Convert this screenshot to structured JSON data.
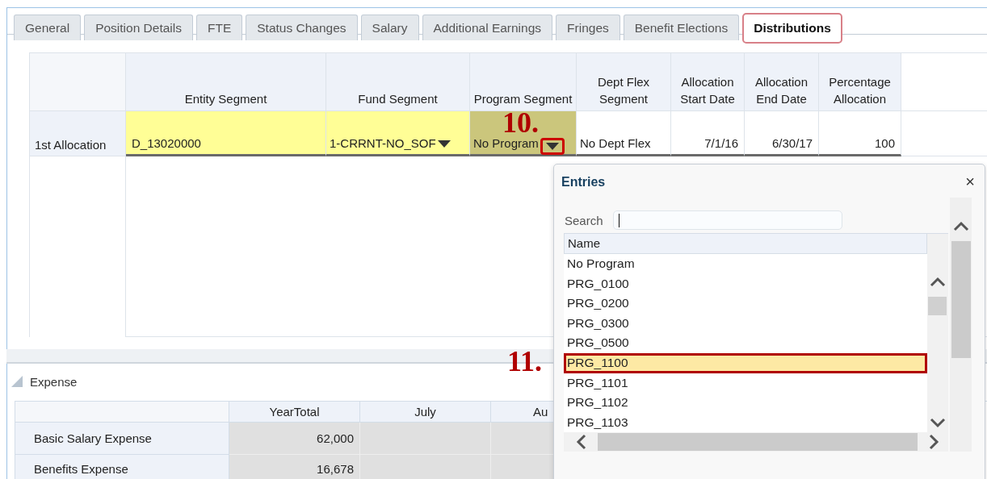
{
  "tabs": [
    {
      "label": "General",
      "selected": false
    },
    {
      "label": "Position Details",
      "selected": false
    },
    {
      "label": "FTE",
      "selected": false
    },
    {
      "label": "Status Changes",
      "selected": false
    },
    {
      "label": "Salary",
      "selected": false
    },
    {
      "label": "Additional Earnings",
      "selected": false
    },
    {
      "label": "Fringes",
      "selected": false
    },
    {
      "label": "Benefit Elections",
      "selected": false
    },
    {
      "label": "Distributions",
      "selected": true
    }
  ],
  "allocation_table": {
    "columns": [
      "Entity Segment",
      "Fund Segment",
      "Program Segment",
      "Dept Flex Segment",
      "Allocation Start Date",
      "Allocation End Date",
      "Percentage Allocation"
    ],
    "rows": [
      {
        "label": "1st Allocation",
        "cells": [
          {
            "kind": "field",
            "value": "D_13020000"
          },
          {
            "kind": "dropdown",
            "value": "1-CRRNT-NO_SOF",
            "active": false
          },
          {
            "kind": "dropdown",
            "value": "No Program",
            "active": true,
            "callout": "10."
          },
          {
            "kind": "text",
            "value": "No Dept Flex"
          },
          {
            "kind": "number",
            "value": "7/1/16"
          },
          {
            "kind": "number",
            "value": "6/30/17"
          },
          {
            "kind": "number",
            "value": "100"
          }
        ]
      }
    ]
  },
  "expense": {
    "title": "Expense",
    "expanded": true,
    "columns": [
      "YearTotal",
      "July",
      "Au"
    ],
    "rows": [
      {
        "label": "Basic Salary Expense",
        "values": [
          "62,000"
        ]
      },
      {
        "label": "Benefits Expense",
        "values": [
          "16,678"
        ]
      }
    ]
  },
  "entries_popup": {
    "title": "Entries",
    "close": "×",
    "search_label": "Search",
    "column": "Name",
    "items": [
      {
        "label": "No Program",
        "selected": false
      },
      {
        "label": "PRG_0100",
        "selected": false
      },
      {
        "label": "PRG_0200",
        "selected": false
      },
      {
        "label": "PRG_0300",
        "selected": false
      },
      {
        "label": "PRG_0500",
        "selected": false
      },
      {
        "label": "PRG_1100",
        "selected": true,
        "callout": "11."
      },
      {
        "label": "PRG_1101",
        "selected": false
      },
      {
        "label": "PRG_1102",
        "selected": false
      },
      {
        "label": "PRG_1103",
        "selected": false
      }
    ]
  }
}
